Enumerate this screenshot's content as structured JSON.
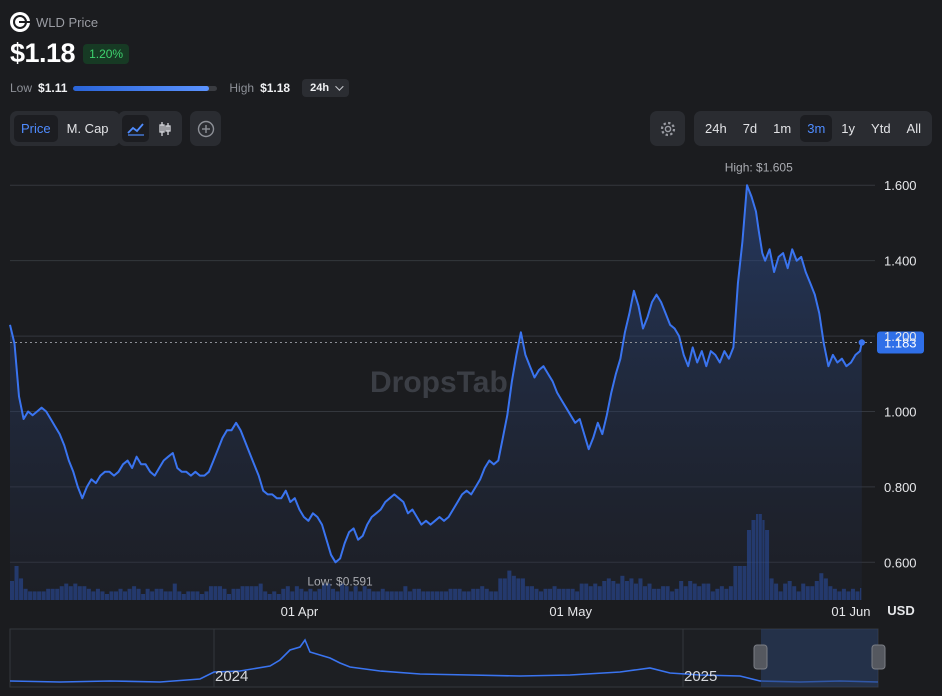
{
  "header": {
    "title": "WLD Price",
    "price": "$1.18",
    "change": "1.20%",
    "low_label": "Low",
    "low_value": "$1.11",
    "high_label": "High",
    "high_value": "$1.18",
    "range_position": 0.94,
    "period": "24h"
  },
  "toolbar": {
    "metric_tabs": [
      {
        "label": "Price",
        "active": true
      },
      {
        "label": "M. Cap",
        "active": false
      }
    ],
    "time_ranges": [
      {
        "label": "24h",
        "active": false
      },
      {
        "label": "7d",
        "active": false
      },
      {
        "label": "1m",
        "active": false
      },
      {
        "label": "3m",
        "active": true
      },
      {
        "label": "1y",
        "active": false
      },
      {
        "label": "Ytd",
        "active": false
      },
      {
        "label": "All",
        "active": false
      }
    ]
  },
  "colors": {
    "line": "#3a74f0",
    "current_badge": "#2f6fe8",
    "positive": "#3ed26e"
  },
  "chart_data": {
    "type": "line",
    "title": "",
    "xlabel": "",
    "ylabel": "",
    "currency_label": "USD",
    "watermark": "DropsTab",
    "ylim": [
      0.5,
      1.72
    ],
    "y_ticks": [
      0.6,
      0.8,
      1.0,
      1.2,
      1.4,
      1.6
    ],
    "y_tick_labels": [
      "0.600",
      "0.800",
      "1.000",
      "1.200",
      "1.400",
      "1.600"
    ],
    "x_range_days": [
      0,
      94
    ],
    "x_ticks": [
      {
        "day": 32,
        "label": "01 Apr"
      },
      {
        "day": 62,
        "label": "01 May"
      },
      {
        "day": 93,
        "label": "01 Jun"
      }
    ],
    "high": {
      "label": "High: $1.605",
      "day": 82.8,
      "value": 1.605
    },
    "low": {
      "label": "Low: $0.591",
      "day": 36.5,
      "value": 0.591
    },
    "current": {
      "label": "1.183",
      "value": 1.183
    },
    "grid": true,
    "series": [
      {
        "x": [
          0,
          0.5,
          1,
          1.5,
          2,
          2.5,
          3,
          3.5,
          4,
          4.5,
          5,
          5.5,
          6,
          6.5,
          7,
          7.5,
          8,
          8.5,
          9,
          9.5,
          10,
          10.5,
          11,
          11.5,
          12,
          12.5,
          13,
          13.5,
          14,
          14.5,
          15,
          15.5,
          16,
          16.5,
          17,
          17.5,
          18,
          18.5,
          19,
          19.5,
          20,
          20.5,
          21,
          21.5,
          22,
          22.5,
          23,
          23.5,
          24,
          24.5,
          25,
          25.5,
          26,
          26.5,
          27,
          27.5,
          28,
          28.5,
          29,
          29.5,
          30,
          30.5,
          31,
          31.5,
          32,
          32.5,
          33,
          33.5,
          34,
          34.5,
          35,
          35.5,
          36,
          36.5,
          37,
          37.5,
          38,
          38.5,
          39,
          39.5,
          40,
          40.5,
          41,
          41.5,
          42,
          42.5,
          43,
          43.5,
          44,
          44.5,
          45,
          45.5,
          46,
          46.5,
          47,
          47.5,
          48,
          48.5,
          49,
          49.5,
          50,
          50.5,
          51,
          51.5,
          52,
          52.5,
          53,
          53.5,
          54,
          54.5,
          55,
          55.5,
          56,
          56.5,
          57,
          57.5,
          58,
          58.5,
          59,
          59.5,
          60,
          60.5,
          61,
          61.5,
          62,
          62.5,
          63,
          63.5,
          64,
          64.5,
          65,
          65.5,
          66,
          66.5,
          67,
          67.5,
          68,
          68.5,
          69,
          69.5,
          70,
          70.5,
          71,
          71.5,
          72,
          72.5,
          73,
          73.5,
          74,
          74.5,
          75,
          75.5,
          76,
          76.5,
          77,
          77.5,
          78,
          78.5,
          79,
          79.5,
          80,
          80.5,
          81,
          81.5,
          82,
          82.5,
          82.8,
          83.2,
          83.5,
          84,
          84.5,
          85,
          85.5,
          86,
          86.5,
          87,
          87.5,
          88,
          88.5,
          89,
          89.5,
          90,
          90.5,
          91,
          91.5,
          92,
          92.5,
          93,
          93.5,
          94,
          94.2
        ],
        "values": [
          1.23,
          1.18,
          1.04,
          0.98,
          1.0,
          0.99,
          1.0,
          1.01,
          1.0,
          0.98,
          0.96,
          0.94,
          0.91,
          0.87,
          0.84,
          0.8,
          0.77,
          0.8,
          0.82,
          0.81,
          0.83,
          0.84,
          0.84,
          0.83,
          0.84,
          0.86,
          0.87,
          0.85,
          0.88,
          0.86,
          0.86,
          0.84,
          0.83,
          0.85,
          0.87,
          0.88,
          0.89,
          0.85,
          0.84,
          0.84,
          0.83,
          0.84,
          0.83,
          0.83,
          0.84,
          0.87,
          0.9,
          0.93,
          0.95,
          0.95,
          0.97,
          0.95,
          0.92,
          0.89,
          0.86,
          0.83,
          0.79,
          0.78,
          0.78,
          0.77,
          0.77,
          0.79,
          0.76,
          0.77,
          0.74,
          0.72,
          0.71,
          0.73,
          0.72,
          0.7,
          0.66,
          0.62,
          0.6,
          0.61,
          0.65,
          0.68,
          0.69,
          0.66,
          0.67,
          0.7,
          0.72,
          0.73,
          0.74,
          0.76,
          0.77,
          0.78,
          0.77,
          0.76,
          0.73,
          0.74,
          0.72,
          0.7,
          0.71,
          0.7,
          0.71,
          0.72,
          0.71,
          0.72,
          0.74,
          0.76,
          0.78,
          0.79,
          0.78,
          0.8,
          0.82,
          0.85,
          0.87,
          0.86,
          0.87,
          0.93,
          0.99,
          1.08,
          1.15,
          1.21,
          1.15,
          1.12,
          1.09,
          1.11,
          1.12,
          1.1,
          1.08,
          1.05,
          1.03,
          1.01,
          0.99,
          0.97,
          0.98,
          0.94,
          0.9,
          0.93,
          0.97,
          0.94,
          0.99,
          1.05,
          1.1,
          1.14,
          1.21,
          1.26,
          1.32,
          1.28,
          1.22,
          1.25,
          1.29,
          1.31,
          1.29,
          1.26,
          1.23,
          1.22,
          1.2,
          1.15,
          1.12,
          1.17,
          1.13,
          1.16,
          1.12,
          1.16,
          1.15,
          1.13,
          1.16,
          1.14,
          1.17,
          1.34,
          1.45,
          1.6,
          1.57,
          1.53,
          1.48,
          1.42,
          1.4,
          1.43,
          1.37,
          1.41,
          1.42,
          1.38,
          1.43,
          1.4,
          1.41,
          1.37,
          1.34,
          1.31,
          1.26,
          1.18,
          1.12,
          1.15,
          1.13,
          1.14,
          1.12,
          1.13,
          1.15,
          1.16,
          1.183
        ]
      }
    ]
  }
}
